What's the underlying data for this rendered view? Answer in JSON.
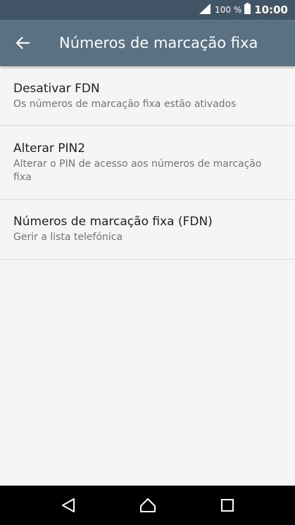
{
  "status_bar": {
    "battery_percent": "100 %",
    "time": "10:00",
    "icons": [
      "signal-icon",
      "battery-icon"
    ]
  },
  "app_bar": {
    "title": "Números de marcação fixa",
    "back_icon": "back-arrow-icon"
  },
  "items": [
    {
      "title": "Desativar FDN",
      "subtitle": "Os números de marcação fixa estão ativados"
    },
    {
      "title": "Alterar PIN2",
      "subtitle": "Alterar o PIN de acesso aos números de marcação fixa"
    },
    {
      "title": "Números de marcação fixa (FDN)",
      "subtitle": "Gerir a lista telefónica"
    }
  ],
  "nav_bar": {
    "buttons": [
      "back-triangle-icon",
      "home-icon",
      "recents-icon"
    ]
  },
  "colors": {
    "status_bar": "#425566",
    "app_bar": "#5a7184",
    "background": "#f5f5f5",
    "nav_bar": "#000000"
  }
}
